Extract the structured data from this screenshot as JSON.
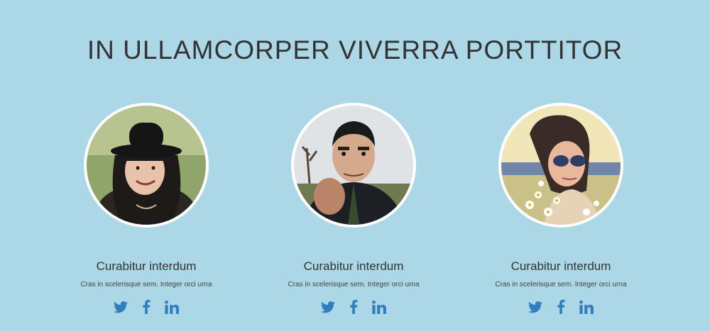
{
  "section": {
    "title": "IN ULLAMCORPER VIVERRA PORTTITOR"
  },
  "members": [
    {
      "name": "Curabitur interdum",
      "description": "Cras in scelerisque sem. Integer orci urna"
    },
    {
      "name": "Curabitur interdum",
      "description": "Cras in scelerisque sem. Integer orci urna"
    },
    {
      "name": "Curabitur interdum",
      "description": "Cras in scelerisque sem. Integer orci urna"
    }
  ],
  "social_icons": [
    "twitter-icon",
    "facebook-icon",
    "linkedin-icon"
  ],
  "colors": {
    "background": "#acd7e6",
    "title_text": "#333333",
    "social_icon": "#2f7fbf",
    "avatar_border": "#ffffff"
  }
}
